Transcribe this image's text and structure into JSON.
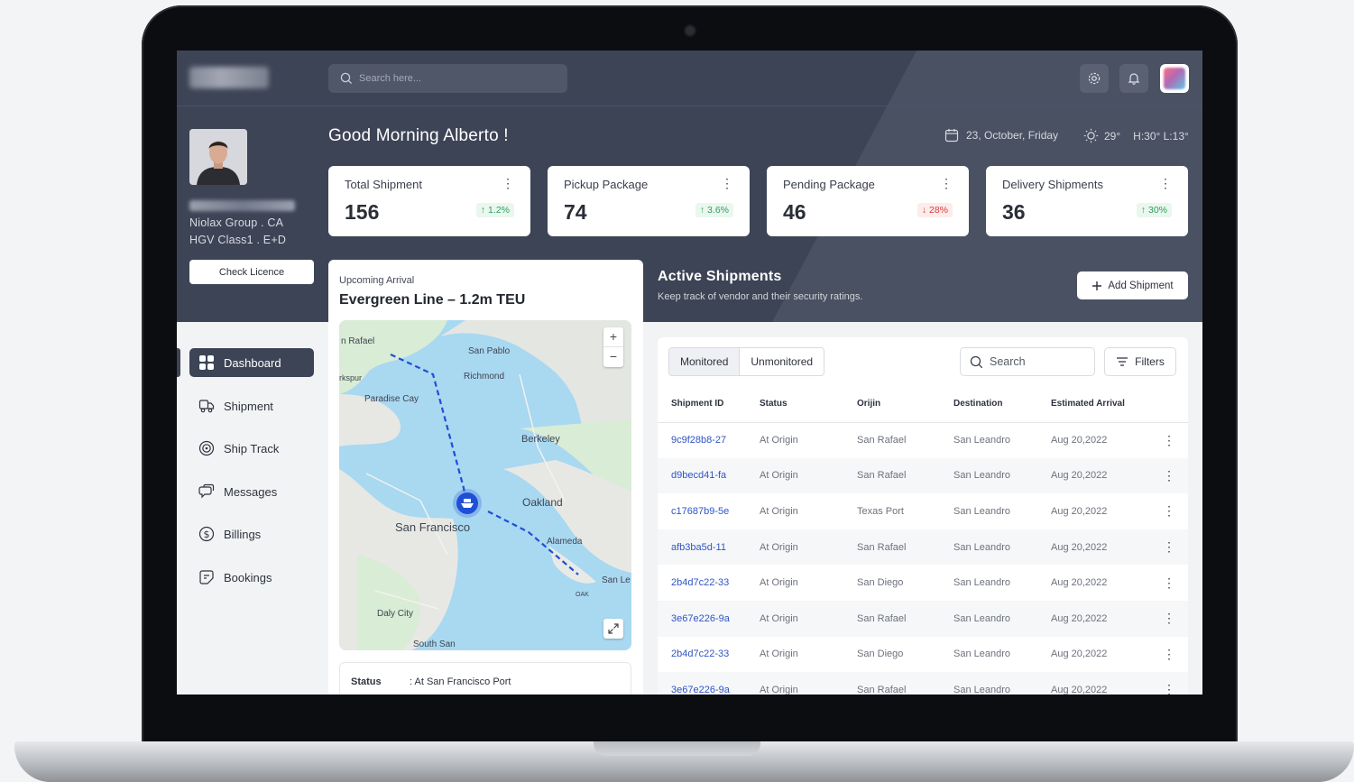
{
  "header": {
    "search_placeholder": "Search here...",
    "icons": [
      "settings-gear-icon",
      "notification-bell-icon"
    ]
  },
  "profile": {
    "company": "Niolax Group  .  CA",
    "licence": "HGV Class1 . E+D",
    "check_licence_label": "Check Licence"
  },
  "greeting": "Good Morning Alberto !",
  "date": "23, October, Friday",
  "weather": {
    "temp": "29°",
    "range": "H:30° L:13°"
  },
  "stats": [
    {
      "title": "Total Shipment",
      "value": "156",
      "change": "↑ 1.2%",
      "trend": "up"
    },
    {
      "title": "Pickup Package",
      "value": "74",
      "change": "↑ 3.6%",
      "trend": "up"
    },
    {
      "title": "Pending Package",
      "value": "46",
      "change": "↓ 28%",
      "trend": "down"
    },
    {
      "title": "Delivery Shipments",
      "value": "36",
      "change": "↑ 30%",
      "trend": "up"
    }
  ],
  "sidebar": {
    "items": [
      {
        "label": "Dashboard",
        "icon": "dashboard-grid-icon",
        "active": true
      },
      {
        "label": "Shipment",
        "icon": "truck-icon",
        "active": false
      },
      {
        "label": "Ship Track",
        "icon": "target-icon",
        "active": false
      },
      {
        "label": "Messages",
        "icon": "chat-bubbles-icon",
        "active": false
      },
      {
        "label": "Billings",
        "icon": "dollar-icon",
        "active": false
      },
      {
        "label": "Bookings",
        "icon": "booking-icon",
        "active": false
      }
    ]
  },
  "arrival": {
    "label": "Upcoming Arrival",
    "title": "Evergreen Line – 1.2m TEU",
    "map_labels": [
      "n Rafael",
      "San Pablo",
      "Richmond",
      "rkspur",
      "Paradise Cay",
      "Berkeley",
      "Oakland",
      "San Francisco",
      "Alameda",
      "San Le",
      "Daly City",
      "South San",
      "OAK"
    ],
    "status_label": "Status",
    "status_value": ": At San Francisco Port"
  },
  "active_shipments": {
    "title": "Active Shipments",
    "subtitle": "Keep track of vendor and their security ratings.",
    "add_label": "Add Shipment",
    "tabs": [
      "Monitored",
      "Unmonitored"
    ],
    "search_placeholder": "Search",
    "filters_label": "Filters",
    "columns": [
      "Shipment ID",
      "Status",
      "Orijin",
      "Destination",
      "Estimated Arrival"
    ],
    "rows": [
      [
        "9c9f28b8-27",
        "At Origin",
        "San Rafael",
        "San Leandro",
        "Aug 20,2022"
      ],
      [
        "d9becd41-fa",
        "At Origin",
        "San Rafael",
        "San Leandro",
        "Aug 20,2022"
      ],
      [
        "c17687b9-5e",
        "At Origin",
        "Texas Port",
        "San Leandro",
        "Aug 20,2022"
      ],
      [
        "afb3ba5d-11",
        "At Origin",
        "San Rafael",
        "San Leandro",
        "Aug 20,2022"
      ],
      [
        "2b4d7c22-33",
        "At Origin",
        "San Diego",
        "San Leandro",
        "Aug 20,2022"
      ],
      [
        "3e67e226-9a",
        "At Origin",
        "San Rafael",
        "San Leandro",
        "Aug 20,2022"
      ],
      [
        "2b4d7c22-33",
        "At Origin",
        "San Diego",
        "San Leandro",
        "Aug 20,2022"
      ],
      [
        "3e67e226-9a",
        "At Origin",
        "San Rafael",
        "San Leandro",
        "Aug 20,2022"
      ]
    ]
  },
  "colors": {
    "dark": "#3d4456",
    "up": "#2f9e5f",
    "down": "#de3b3b",
    "link": "#2f55c4",
    "route": "#1e4fd6"
  }
}
